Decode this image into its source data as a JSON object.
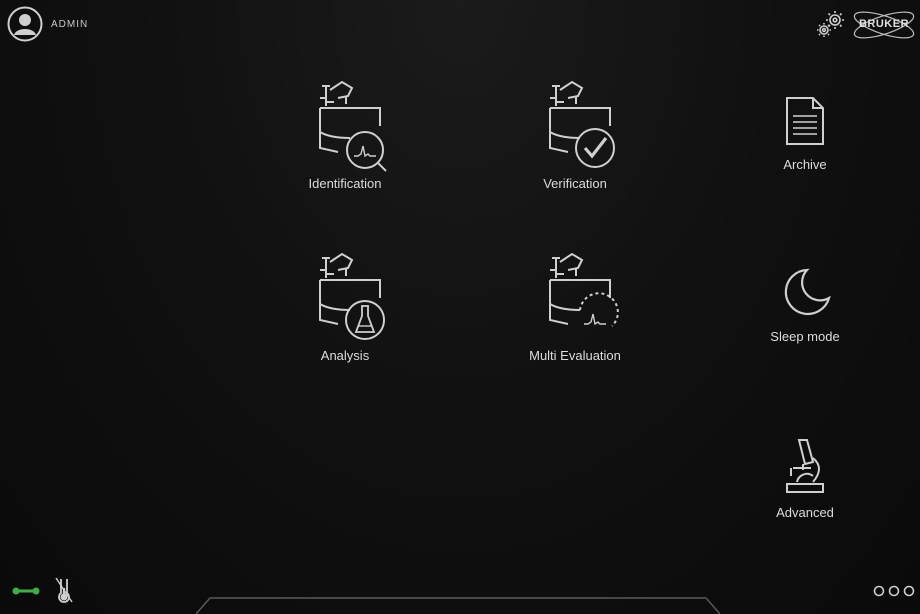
{
  "header": {
    "user": {
      "name": "ADMIN",
      "icon": "user-avatar-icon"
    },
    "settings_icon": "gears-icon",
    "brand": {
      "name": "BRUKER"
    }
  },
  "tiles": [
    {
      "label": "Identification",
      "icon": "instrument-magnifier-spectrum-icon"
    },
    {
      "label": "Verification",
      "icon": "instrument-checkmark-icon"
    },
    {
      "label": "Analysis",
      "icon": "instrument-flask-icon"
    },
    {
      "label": "Multi Evaluation",
      "icon": "instrument-spectrum-loop-icon"
    }
  ],
  "side": [
    {
      "label": "Archive",
      "icon": "document-icon"
    },
    {
      "label": "Sleep mode",
      "icon": "moon-icon"
    },
    {
      "label": "Advanced",
      "icon": "microscope-icon"
    }
  ],
  "status": {
    "connection_color": "#3cb043",
    "connection_icon": "connection-icon",
    "temperature_icon": "thermometer-icon"
  },
  "footer": {
    "more_icon": "more-dots-icon"
  },
  "colors": {
    "background": "#0d0d0d",
    "icon_stroke": "#cfcfcf",
    "accent": "#3cb043"
  }
}
